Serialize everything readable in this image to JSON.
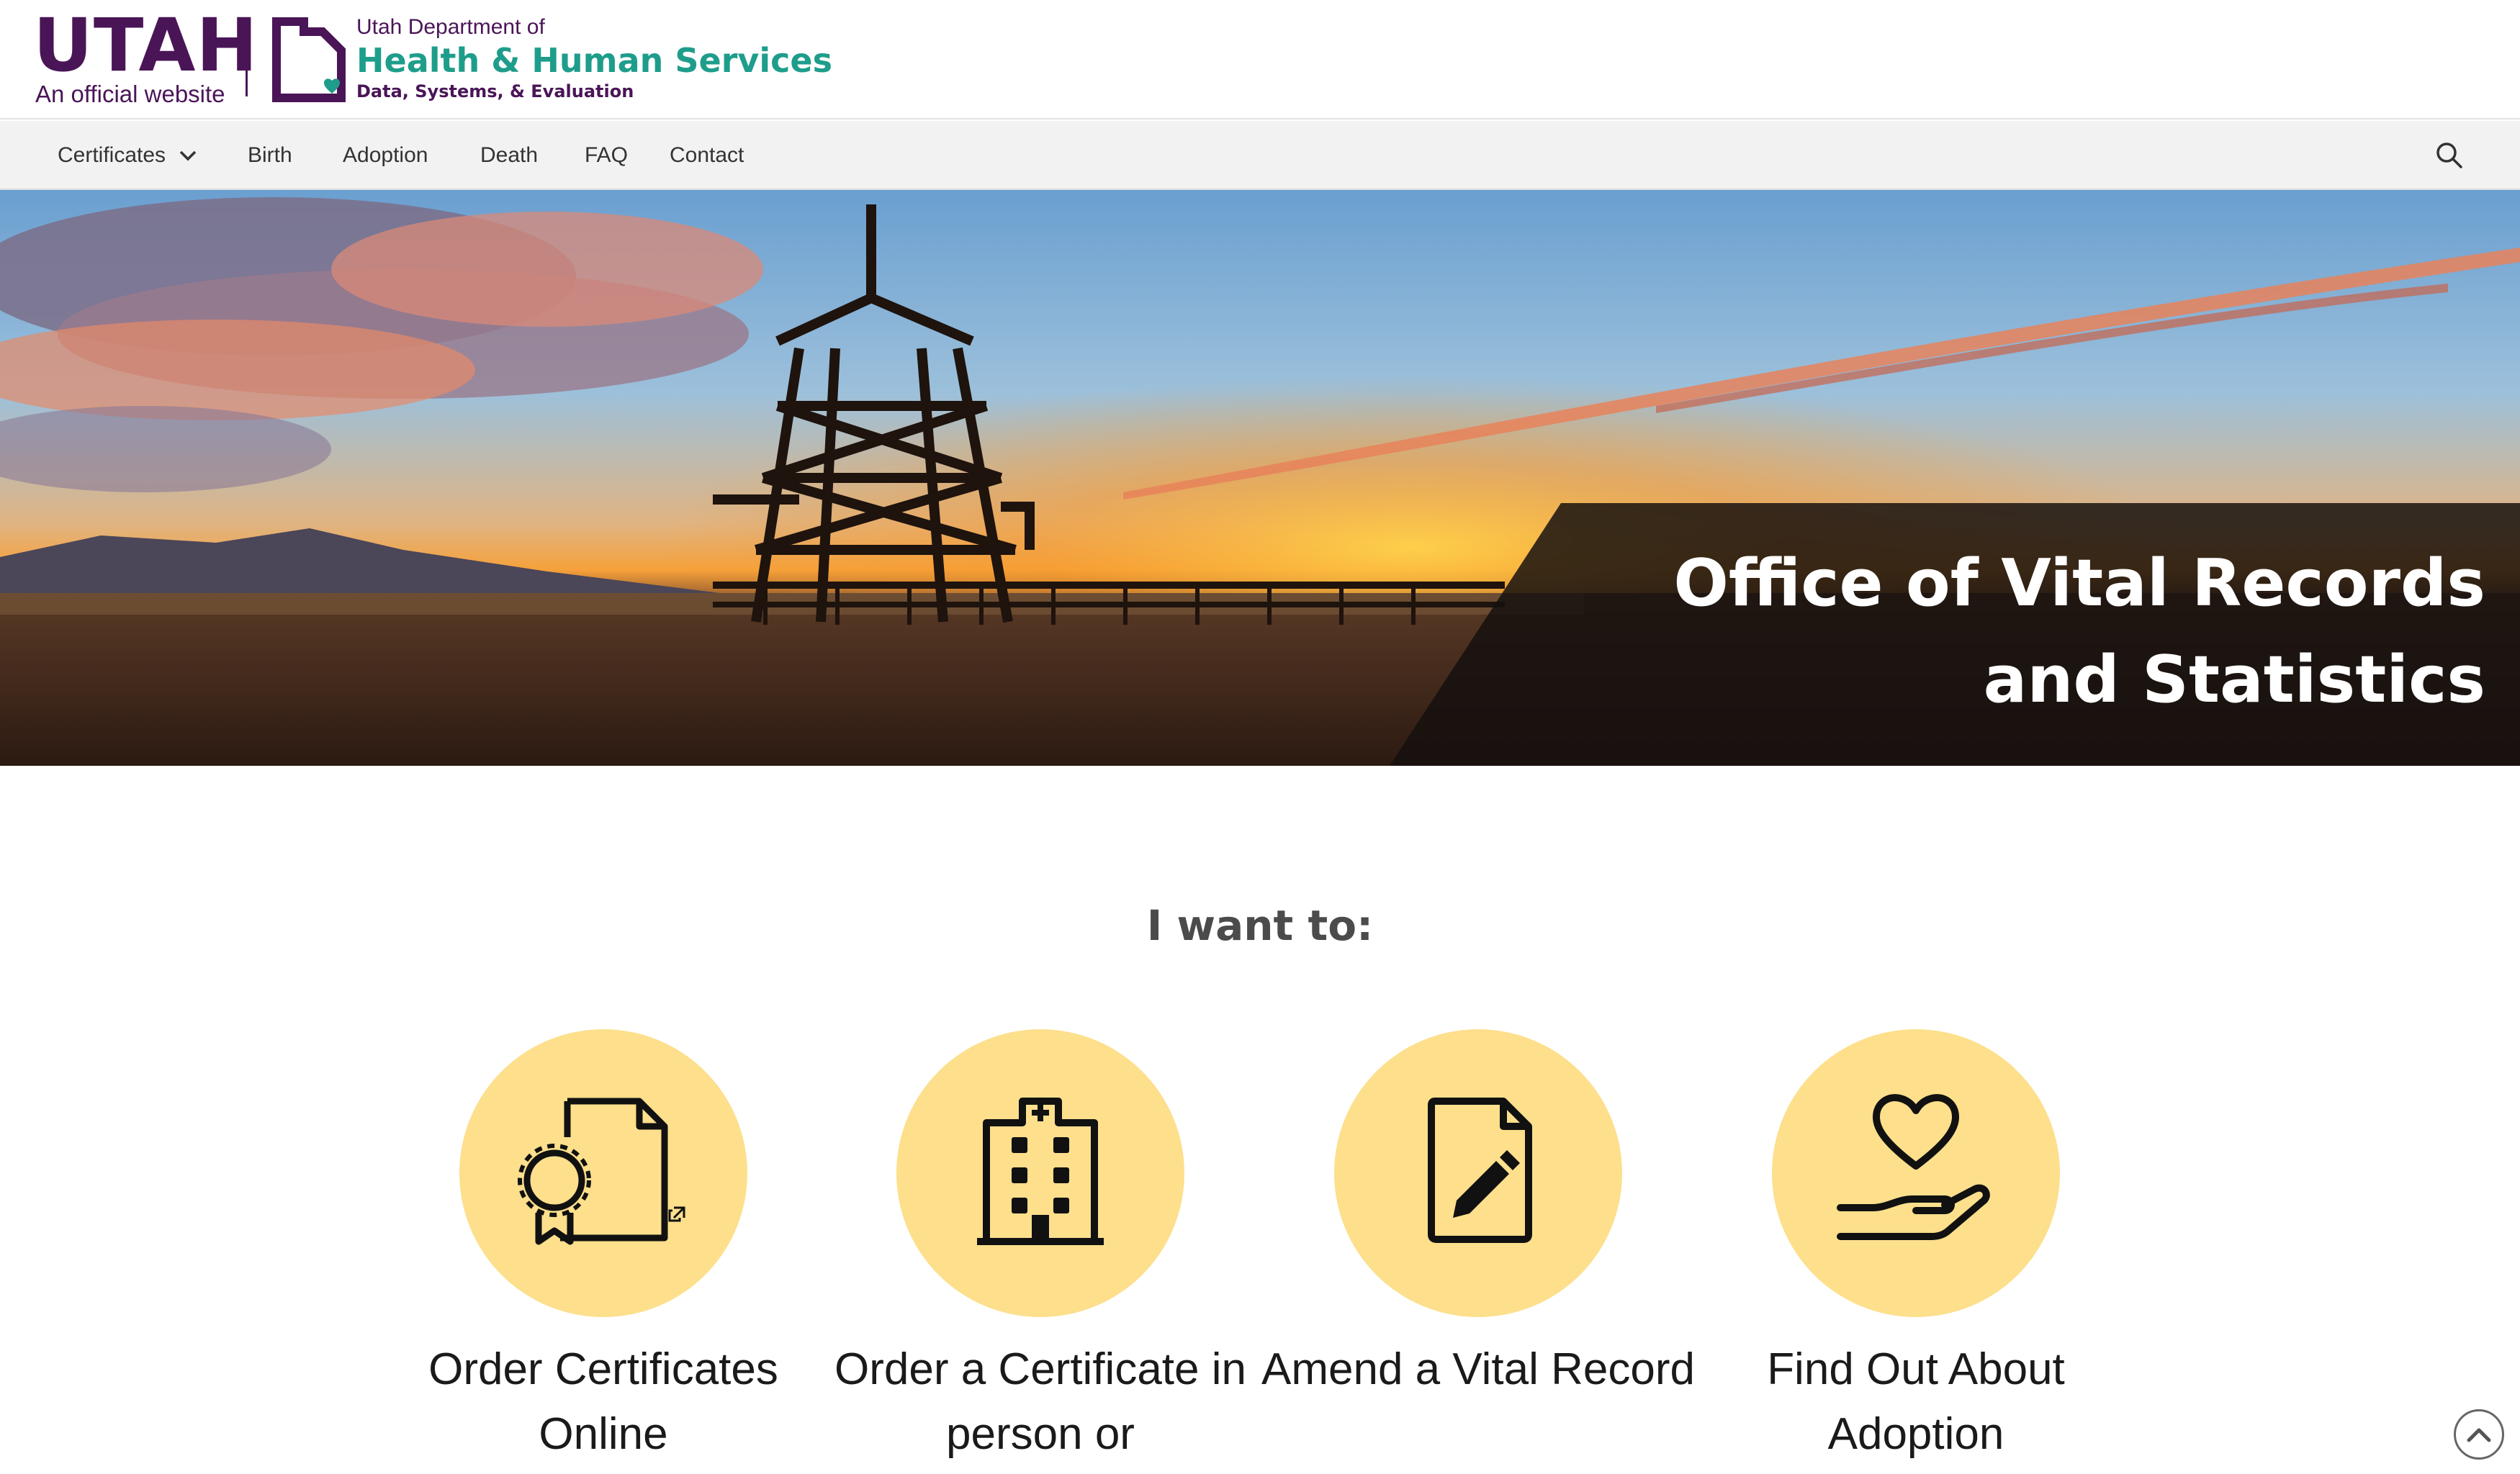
{
  "header": {
    "utah_wordmark": "UTAH",
    "utah_subtitle": "An official website",
    "dept_line1": "Utah Department of",
    "dept_line2": "Health & Human Services",
    "dept_line3": "Data, Systems, & Evaluation"
  },
  "nav": {
    "items": [
      {
        "label": "Certificates",
        "has_dropdown": true
      },
      {
        "label": "Birth"
      },
      {
        "label": "Adoption"
      },
      {
        "label": "Death"
      },
      {
        "label": "FAQ"
      },
      {
        "label": "Contact"
      }
    ],
    "search_icon": "search-icon"
  },
  "hero": {
    "title": "Office of Vital Records and Statistics"
  },
  "want": {
    "heading": "I want to:",
    "cards": [
      {
        "label": "Order Certificates Online",
        "icon": "certificate-external-icon"
      },
      {
        "label": "Order a Certificate in person or",
        "icon": "hospital-building-icon"
      },
      {
        "label": "Amend a Vital Record",
        "icon": "document-edit-icon"
      },
      {
        "label": "Find Out About Adoption",
        "icon": "heart-hand-icon"
      }
    ]
  },
  "colors": {
    "brand_purple": "#4a1557",
    "brand_teal": "#1e9d8b",
    "circle_yellow": "#fddf8c"
  }
}
